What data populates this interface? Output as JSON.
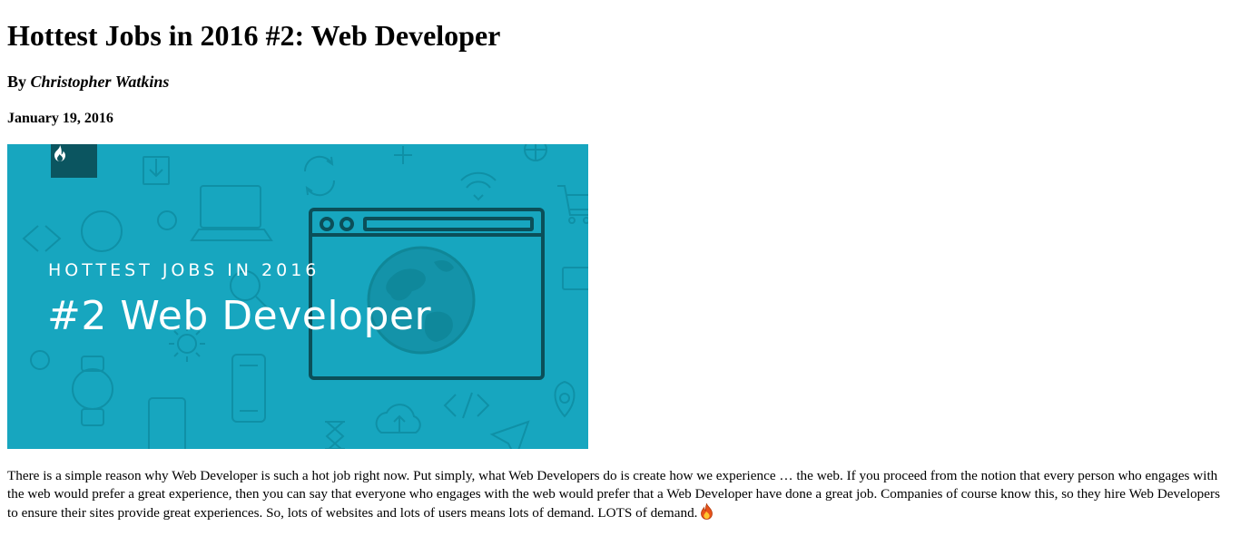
{
  "article": {
    "title": "Hottest Jobs in 2016 #2: Web Developer",
    "byline_prefix": "By ",
    "author": "Christopher Watkins",
    "date": "January 19, 2016",
    "hero": {
      "kicker": "HOTTEST JOBS IN 2016",
      "headline": "#2 Web Developer",
      "background_color": "#17a6bf",
      "badge_color": "#0b5560",
      "badge_icon": "flame-icon"
    },
    "body": "There is a simple reason why Web Developer is such a hot job right now. Put simply, what Web Developers do is create how we experience … the web. If you proceed from the notion that every person who engages with the web would prefer a great experience, then you can say that everyone who engages with the web would prefer that a Web Developer have done a great job. Companies of course know this, so they hire Web Developers to ensure their sites provide great experiences. So, lots of websites and lots of users means lots of demand. LOTS of demand.",
    "end_icon": "fire-emoji-icon"
  }
}
